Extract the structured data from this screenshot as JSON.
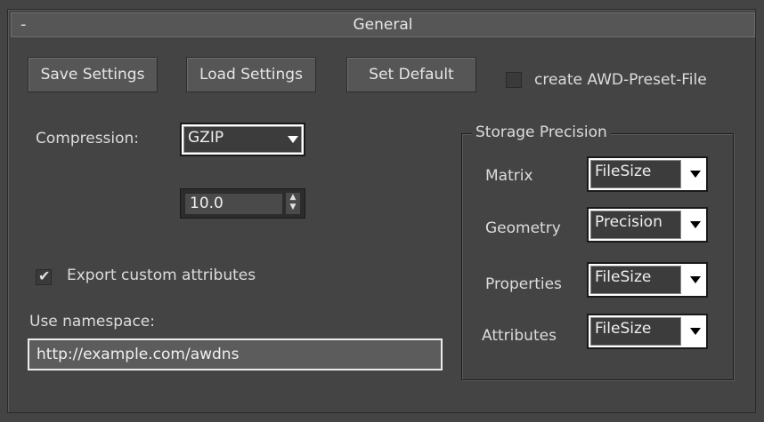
{
  "rollout": {
    "title": "General",
    "collapse_symbol": "-"
  },
  "buttons": {
    "save": "Save Settings",
    "load": "Load Settings",
    "set_default": "Set Default"
  },
  "preset": {
    "label": "create AWD-Preset-File",
    "checked": false
  },
  "compression": {
    "label": "Compression:",
    "selected": "GZIP",
    "level": "10.0"
  },
  "export_attributes": {
    "label": "Export custom attributes",
    "checked": true,
    "check_glyph": "✔"
  },
  "namespace": {
    "label": "Use namespace:",
    "value": "http://example.com/awdns"
  },
  "storage_precision": {
    "title": "Storage Precision",
    "rows": [
      {
        "label": "Matrix",
        "value": "FileSize"
      },
      {
        "label": "Geometry",
        "value": "Precision"
      },
      {
        "label": "Properties",
        "value": "FileSize"
      },
      {
        "label": "Attributes",
        "value": "FileSize"
      }
    ]
  },
  "icons": {
    "spinner_up": "▲",
    "spinner_down": "▼"
  }
}
